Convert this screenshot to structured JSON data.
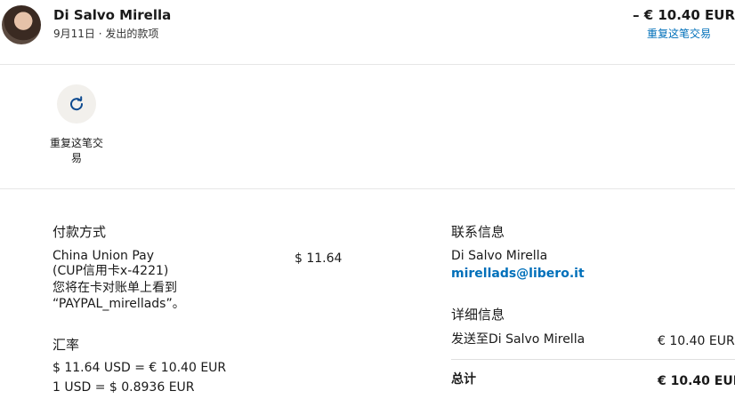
{
  "header": {
    "name": "Di Salvo Mirella",
    "subtitle": "9月11日 · 发出的款项",
    "amount": "– € 10.40 EUR",
    "repeat_link": "重复这笔交易"
  },
  "actions": {
    "repeat_label_line1": "重复这笔交",
    "repeat_label_line2": "易"
  },
  "payment": {
    "title": "付款方式",
    "method_line1": "China Union Pay",
    "method_line2": "(CUP信用卡x-4221)",
    "method_line3": "您将在卡对账单上看到",
    "method_line4": "“PAYPAL_mirellads”。",
    "amount": "$ 11.64",
    "exchange_title": "汇率",
    "exchange_line1": "$ 11.64 USD = € 10.40 EUR",
    "exchange_line2": "1 USD = $ 0.8936 EUR"
  },
  "contact": {
    "title": "联系信息",
    "name": "Di Salvo Mirella",
    "email": "mirellads@libero.it"
  },
  "details": {
    "title": "详细信息",
    "row_label": "发送至Di Salvo Mirella",
    "row_value": "€ 10.40 EUR",
    "total_label": "总计",
    "total_value": "€ 10.40 EUR"
  }
}
